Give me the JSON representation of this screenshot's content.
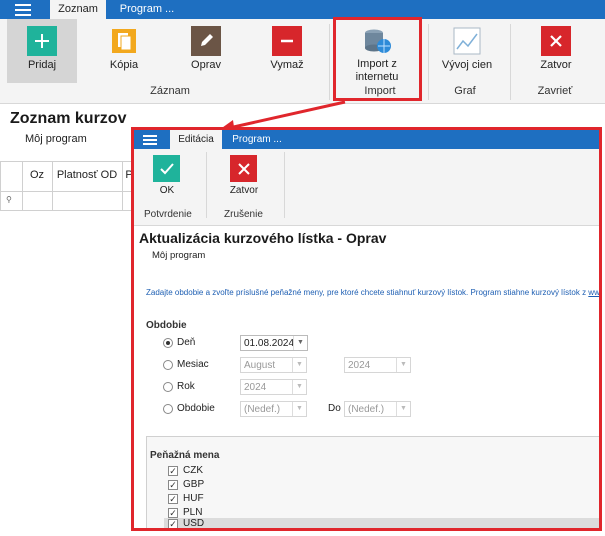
{
  "main": {
    "tabs": [
      {
        "label": "Zoznam",
        "active": true
      },
      {
        "label": "Program ...",
        "active": false
      }
    ],
    "ribbon": {
      "buttons": [
        {
          "label": "Pridaj",
          "icon": "plus-icon"
        },
        {
          "label": "Kópia",
          "icon": "copy-icon"
        },
        {
          "label": "Oprav",
          "icon": "pencil-icon"
        },
        {
          "label": "Vymaž",
          "icon": "minus-icon"
        },
        {
          "label": "Import z internetu",
          "icon": "database-globe-icon"
        },
        {
          "label": "Vývoj cien",
          "icon": "line-chart-icon"
        },
        {
          "label": "Zatvor",
          "icon": "close-icon"
        }
      ],
      "groups": [
        "Záznam",
        "Import",
        "Graf",
        "Zavrieť"
      ]
    },
    "page_title": "Zoznam kurzov",
    "page_subtitle": "Môj program",
    "grid": {
      "columns": [
        "Oz",
        "Platnosť OD",
        "P"
      ]
    }
  },
  "dialog": {
    "tabs": [
      {
        "label": "Editácia",
        "active": true
      },
      {
        "label": "Program ...",
        "active": false
      }
    ],
    "ribbon": {
      "buttons": [
        {
          "label": "OK",
          "icon": "check-icon"
        },
        {
          "label": "Zatvor",
          "icon": "close-icon"
        }
      ],
      "groups": [
        "Potvrdenie",
        "Zrušenie"
      ]
    },
    "title": "Aktualizácia kurzového lístka - Oprav",
    "subtitle": "Môj program",
    "info_text": "Zadajte obdobie a zvoľte príslušné peňažné meny, pre ktoré chcete stiahnuť kurzový lístok. Program stiahne kurzový lístok z ",
    "info_link": "www.ecb.int",
    "period": {
      "heading": "Obdobie",
      "options": [
        {
          "label": "Deň",
          "selected": true
        },
        {
          "label": "Mesiac",
          "selected": false
        },
        {
          "label": "Rok",
          "selected": false
        },
        {
          "label": "Obdobie",
          "selected": false
        }
      ],
      "day_value": "01.08.2024",
      "month_value": "August",
      "month_year_value": "2024",
      "year_value": "2024",
      "from_value": "(Nedef.)",
      "to_label": "Do",
      "to_value": "(Nedef.)"
    },
    "currency": {
      "heading": "Peňažná mena",
      "items": [
        {
          "code": "CZK",
          "checked": true
        },
        {
          "code": "GBP",
          "checked": true
        },
        {
          "code": "HUF",
          "checked": true
        },
        {
          "code": "PLN",
          "checked": true
        },
        {
          "code": "USD",
          "checked": true
        }
      ]
    }
  },
  "colors": {
    "accent": "#1e6fc1",
    "callout": "#e0262c",
    "green": "#1fb39b",
    "red": "#d7262b"
  }
}
